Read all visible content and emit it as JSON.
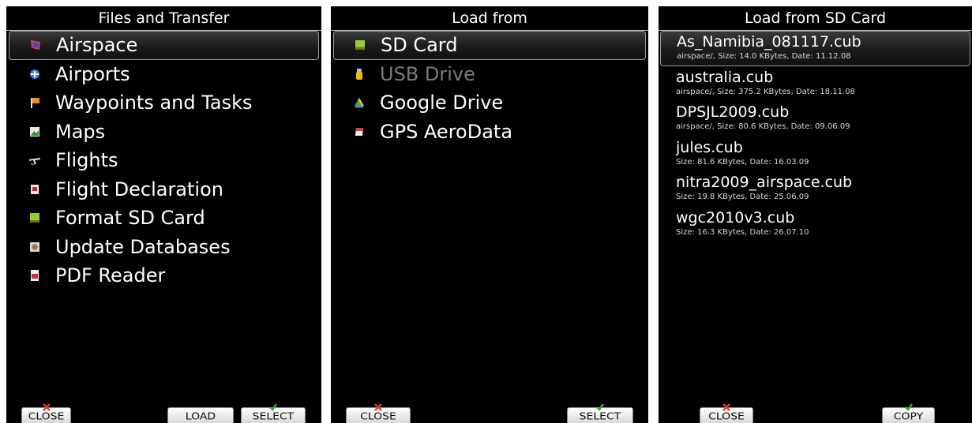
{
  "panel1": {
    "title": "Files and Transfer",
    "items": [
      {
        "label": "Airspace",
        "icon": "airspace-icon"
      },
      {
        "label": "Airports",
        "icon": "airport-icon"
      },
      {
        "label": "Waypoints and Tasks",
        "icon": "waypoint-flag-icon"
      },
      {
        "label": "Maps",
        "icon": "map-icon"
      },
      {
        "label": "Flights",
        "icon": "glider-icon"
      },
      {
        "label": "Flight Declaration",
        "icon": "declaration-icon"
      },
      {
        "label": "Format SD Card",
        "icon": "sd-card-icon"
      },
      {
        "label": "Update Databases",
        "icon": "database-icon"
      },
      {
        "label": "PDF Reader",
        "icon": "pdf-icon"
      }
    ],
    "buttons": {
      "close": "CLOSE",
      "load": "LOAD",
      "select": "SELECT"
    }
  },
  "panel2": {
    "title": "Load from",
    "items": [
      {
        "label": "SD Card",
        "icon": "sd-card-icon",
        "enabled": true
      },
      {
        "label": "USB Drive",
        "icon": "usb-drive-icon",
        "enabled": false
      },
      {
        "label": "Google Drive",
        "icon": "google-drive-icon",
        "enabled": true
      },
      {
        "label": "GPS AeroData",
        "icon": "gps-aerodata-icon",
        "enabled": true
      }
    ],
    "buttons": {
      "close": "CLOSE",
      "select": "SELECT"
    }
  },
  "panel3": {
    "title": "Load from SD Card",
    "files": [
      {
        "name": "As_Namibia_081117.cub",
        "meta": "airspace/, Size: 14.0 KBytes, Date: 11.12.08"
      },
      {
        "name": "australia.cub",
        "meta": "airspace/, Size: 375.2 KBytes, Date: 18.11.08"
      },
      {
        "name": "DPSJL2009.cub",
        "meta": "airspace/, Size: 80.6 KBytes, Date: 09.06.09"
      },
      {
        "name": "jules.cub",
        "meta": "Size: 81.6 KBytes, Date: 16.03.09"
      },
      {
        "name": "nitra2009_airspace.cub",
        "meta": "Size: 19.8 KBytes, Date: 25.06.09"
      },
      {
        "name": "wgc2010v3.cub",
        "meta": "Size: 16.3 KBytes, Date: 26.07.10"
      }
    ],
    "buttons": {
      "close": "CLOSE",
      "copy": "COPY"
    }
  },
  "colors": {
    "background": "#000000",
    "close_mark": "#e53935",
    "ok_mark": "#43a047"
  }
}
